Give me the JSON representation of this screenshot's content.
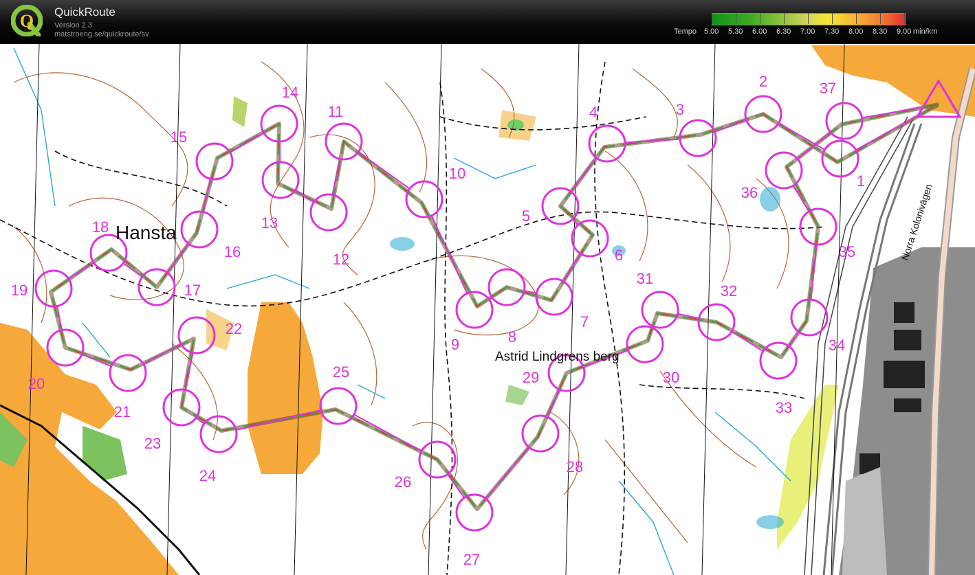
{
  "app": {
    "title": "QuickRoute",
    "version": "Version 2.3",
    "url": "matstroeng.se/quickroute/sv",
    "logo_letter": "Q"
  },
  "legend": {
    "label": "Tempo",
    "unit": "min/km",
    "ticks": [
      "5.00",
      "5.30",
      "6.00",
      "6.30",
      "7.00",
      "7.30",
      "8.00",
      "8.30",
      "9.00"
    ]
  },
  "map": {
    "place_names": [
      "Hansta",
      "Astrid Lindgrens berg",
      "Norra Kolonivägen"
    ],
    "controls": [
      "1",
      "2",
      "3",
      "4",
      "5",
      "6",
      "7",
      "8",
      "9",
      "10",
      "11",
      "12",
      "13",
      "14",
      "15",
      "16",
      "17",
      "18",
      "19",
      "20",
      "21",
      "22",
      "23",
      "24",
      "25",
      "26",
      "27",
      "28",
      "29",
      "30",
      "31",
      "32",
      "33",
      "34",
      "35",
      "36",
      "37"
    ]
  },
  "colors": {
    "course": "#dd33dd",
    "contour": "#b5663a",
    "open_land": "#f6a83a",
    "water_marsh": "#2aa7d6",
    "vegetation_green": "#5dbb4a",
    "route_slow": "#c24a3a",
    "route_fast": "#3f9a3a"
  }
}
